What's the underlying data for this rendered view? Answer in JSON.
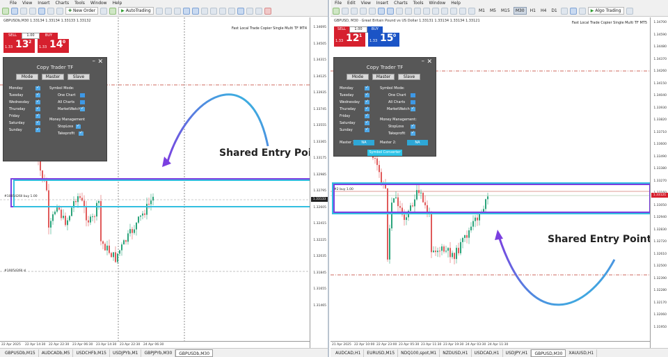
{
  "colors": {
    "sell": "#d6202e",
    "buy": "#1b54c6",
    "panel_bg": "#575757",
    "highlight_purple": "#7b3fe0",
    "highlight_cyan": "#33bfe0",
    "candle_bull": "#2aa37a",
    "candle_bear": "#e05a5a"
  },
  "left": {
    "menu": [
      "File",
      "View",
      "Insert",
      "Charts",
      "Tools",
      "Window",
      "Help"
    ],
    "toolbar": {
      "new_order": "New Order",
      "auto_trading": "AutoTrading"
    },
    "chart": {
      "symbol_title": "GBPUSDb,M30 1.33134 1.33134 1.33133 1.33132",
      "ea_title": "Fast Local Trade Copier Single Multi TF MT4",
      "trade_panel": {
        "sell": "SELL",
        "buy": "BUY",
        "lot": "1.00",
        "sell_spread": "1.33",
        "sell_big": "13",
        "sell_sup": "2",
        "buy_spread": "1.33",
        "buy_big": "14",
        "buy_sup": "0"
      },
      "price_ticks": [
        "1.34695",
        "1.34505",
        "1.34315",
        "1.34125",
        "1.33935",
        "1.33745",
        "1.33555",
        "1.33365",
        "1.33175",
        "1.32985",
        "1.32795",
        "1.32605",
        "1.32415",
        "1.32225",
        "1.32035",
        "1.31845",
        "1.31655",
        "1.31465"
      ],
      "current_price": "1.33133",
      "order_label": "#1005426ll buy 1.00",
      "order_label_sl": "#1005426ll sl",
      "time_ticks": [
        "22 Apr 2025",
        "22 Apr 14:30",
        "22 Apr 22:30",
        "23 Apr 06:30",
        "23 Apr 14:30",
        "23 Apr 22:30",
        "24 Apr 06:30"
      ],
      "shared_label": "Shared Entry Point"
    },
    "copy_trader": {
      "title": "Copy Trader TF",
      "tabs": [
        "Mode",
        "Master",
        "Slave"
      ],
      "days": [
        "Monday",
        "Tuesday",
        "Wednesday",
        "Thursday",
        "Friday",
        "Saturday",
        "Sunday"
      ],
      "symbol_mode": "Symbol Mode:",
      "one_chart": "One Chart",
      "all_charts": "All Charts",
      "market_watch": "MarketWatch",
      "money_mgmt": "Money Management",
      "stoploss": "StopLoss",
      "takeprofit": "Takeprofit"
    },
    "bottom_tabs": [
      "GBPUSDb,M15",
      "AUDCADb,M5",
      "USDCHFb,M15",
      "USDJPYb,M1",
      "GBPJPYb,M30",
      "GBPUSDb,M30"
    ],
    "active_tab": "GBPUSDb,M30"
  },
  "right": {
    "menu": [
      "File",
      "Edit",
      "View",
      "Insert",
      "Charts",
      "Tools",
      "Window",
      "Help"
    ],
    "timeframes": [
      "M1",
      "M5",
      "M15",
      "M30",
      "H1",
      "H4",
      "D1"
    ],
    "active_tf": "M30",
    "algo": "Algo Trading",
    "chart": {
      "symbol_title": "GBPUSD, M30 · Great Britain Pound vs US Dollar 1.33131 1.33134 1.33134 1.33121",
      "ea_title": "Fast Local Trade Copier Single Multi TF MT5",
      "trade_panel": {
        "sell": "SELL",
        "buy": "BUY",
        "lot": "1.00",
        "sell_spread": "1.33",
        "sell_big": "12",
        "sell_sup": "1",
        "buy_spread": "1.33",
        "buy_big": "15",
        "buy_sup": "0"
      },
      "price_ticks": [
        "1.34700",
        "1.34590",
        "1.34480",
        "1.34370",
        "1.34260",
        "1.34150",
        "1.34040",
        "1.33930",
        "1.33820",
        "1.33710",
        "1.33600",
        "1.33490",
        "1.33380",
        "1.33270",
        "1.33160",
        "1.33050",
        "1.32940",
        "1.32830",
        "1.32720",
        "1.32610",
        "1.32500",
        "1.32390",
        "1.32280",
        "1.32170",
        "1.32060",
        "1.31950"
      ],
      "current_price": "1.33121",
      "order_label": "#2 buy 1.00",
      "time_ticks": [
        "21 Apr 2025",
        "22 Apr 10:00",
        "22 Apr 23:00",
        "23 Apr 05:30",
        "23 Apr 11:30",
        "23 Apr 19:30",
        "24 Apr 03:30",
        "24 Apr 11:30"
      ],
      "shared_label": "Shared Entry Point"
    },
    "copy_trader": {
      "title": "Copy Trader TF",
      "tabs": [
        "Mode",
        "Master",
        "Slave"
      ],
      "days": [
        "Monday",
        "Tuesday",
        "Wednesday",
        "Thursday",
        "Friday",
        "Saturday",
        "Sunday"
      ],
      "symbol_mode": "Symbol Mode:",
      "one_chart": "One Chart",
      "all_charts": "All Charts",
      "market_watch": "MarketWatch",
      "money_mgmt": "Money Management:",
      "stoploss": "StopLoss",
      "takeprofit": "Takeprofit",
      "master1": "Master 1:",
      "master2": "Master 2:",
      "na1": "NA",
      "na2": "NA",
      "symbol_converter": "Symbol Converter"
    },
    "bottom_tabs": [
      "AUDCAD,H1",
      "EURUSD,M15",
      "NDQ100,spot,M1",
      "NZDUSD,H1",
      "USDCAD,H1",
      "USDJPY,H1",
      "GBPUSD,M30",
      "XAUUSD,H1"
    ],
    "active_tab": "GBPUSD,M30"
  }
}
